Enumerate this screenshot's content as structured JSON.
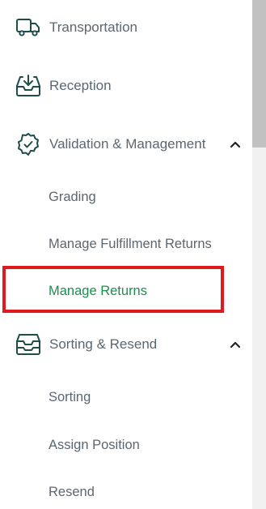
{
  "nav": {
    "transportation": {
      "label": "Transportation",
      "icon": "truck-icon"
    },
    "reception": {
      "label": "Reception",
      "icon": "inbox-download-icon"
    },
    "validation": {
      "label": "Validation & Management",
      "icon": "badge-check-icon",
      "expanded": true,
      "children": [
        {
          "label": "Grading"
        },
        {
          "label": "Manage Fulfillment Returns"
        },
        {
          "label": "Manage Returns",
          "active": true
        }
      ]
    },
    "sorting": {
      "label": "Sorting & Resend",
      "icon": "tray-stack-icon",
      "expanded": true,
      "children": [
        {
          "label": "Sorting"
        },
        {
          "label": "Assign Position"
        },
        {
          "label": "Resend"
        }
      ]
    }
  },
  "colors": {
    "text": "#5b6770",
    "icon": "#1e4d4a",
    "active": "#1a8f4e",
    "highlight": "#e0191f"
  }
}
